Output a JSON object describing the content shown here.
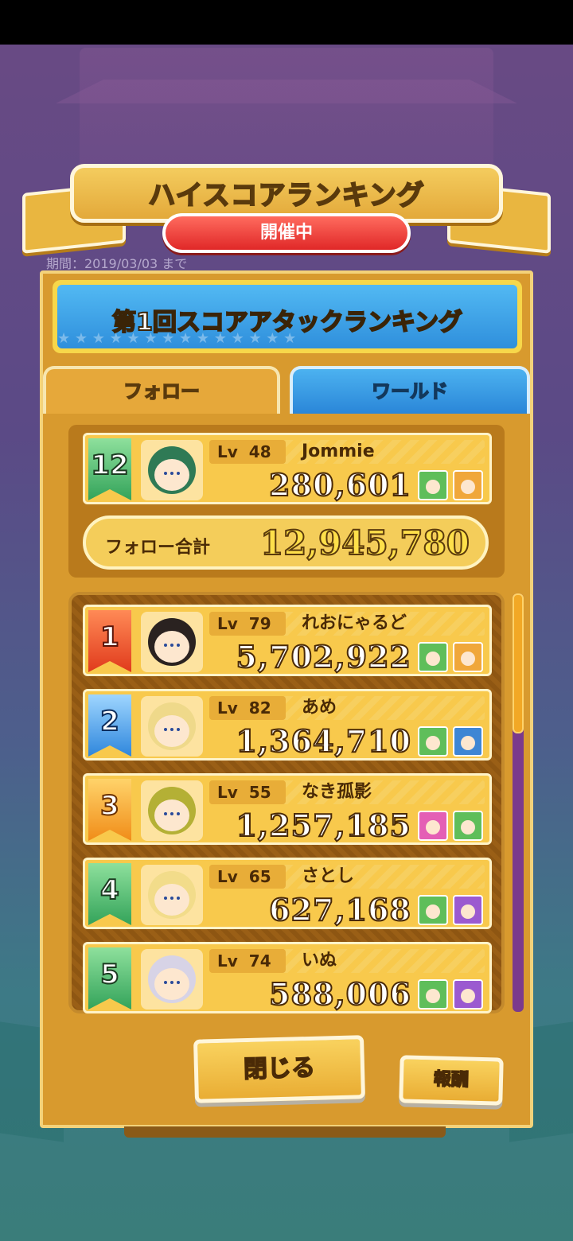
{
  "header": {
    "title": "ハイスコアランキング",
    "status": "開催中",
    "period": "期間：2019/03/03 まで"
  },
  "event": {
    "title": "第1回スコアアタックランキング"
  },
  "tabs": [
    {
      "label": "フォロー",
      "active": true
    },
    {
      "label": "ワールド",
      "active": false
    }
  ],
  "me": {
    "rank": "12",
    "lv_label": "Lv",
    "level": "48",
    "name": "Jommie",
    "score": "280,601",
    "avatar_icon": "character-avatar-icon",
    "team": [
      "team-character-icon",
      "team-character-icon"
    ]
  },
  "follow_total": {
    "label": "フォロー合計",
    "value": "12,945,780"
  },
  "ranking": [
    {
      "rank": "1",
      "lv_label": "Lv",
      "level": "79",
      "name": "れおにゃるど",
      "score": "5,702,922",
      "badge": "red",
      "hair": "dark",
      "team": [
        "green",
        "orange"
      ]
    },
    {
      "rank": "2",
      "lv_label": "Lv",
      "level": "82",
      "name": "あめ",
      "score": "1,364,710",
      "badge": "blue",
      "hair": "blond",
      "team": [
        "green",
        "blue"
      ]
    },
    {
      "rank": "3",
      "lv_label": "Lv",
      "level": "55",
      "name": "なき孤影",
      "score": "1,257,185",
      "badge": "orange",
      "hair": "gold",
      "team": [
        "pink",
        "green"
      ]
    },
    {
      "rank": "4",
      "lv_label": "Lv",
      "level": "65",
      "name": "さとし",
      "score": "627,168",
      "badge": "green",
      "hair": "yellow",
      "team": [
        "green",
        "purple"
      ]
    },
    {
      "rank": "5",
      "lv_label": "Lv",
      "level": "74",
      "name": "いぬ",
      "score": "588,006",
      "badge": "green",
      "hair": "white",
      "team": [
        "green",
        "purple"
      ]
    }
  ],
  "buttons": {
    "close": "閉じる",
    "reward": "報酬"
  },
  "colors": {
    "panel": "#d89a2e",
    "card": "#f8c94c",
    "tab_active": "#e6a83a",
    "tab_inactive": "#2a86d8",
    "live": "#e02828"
  }
}
